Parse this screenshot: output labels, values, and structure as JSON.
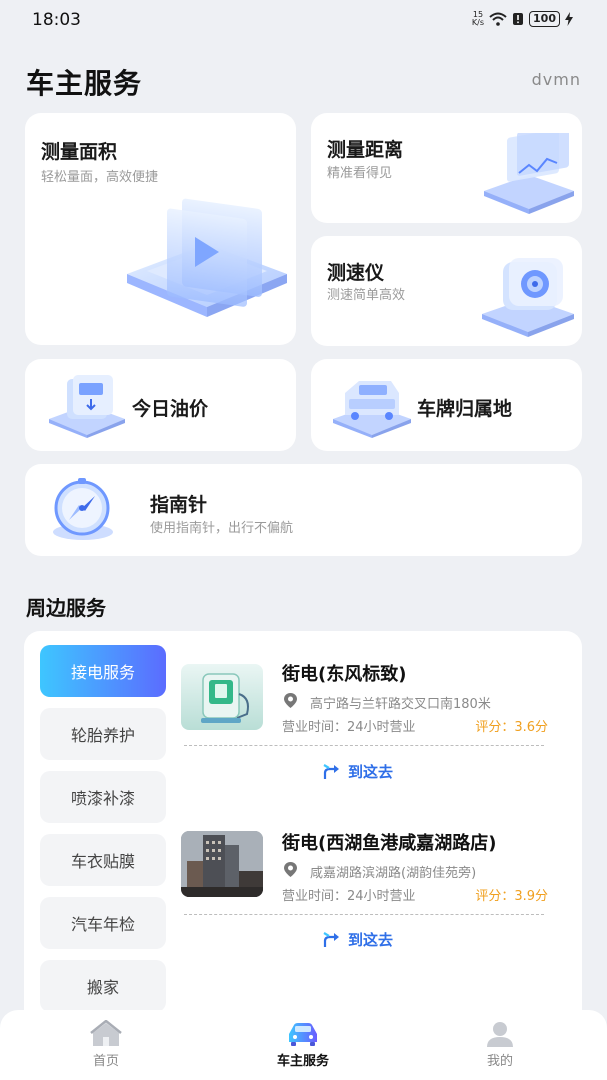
{
  "status": {
    "time": "18:03",
    "speed_top": "15",
    "speed_unit": "K/s",
    "battery": "100"
  },
  "header": {
    "title": "车主服务",
    "user": "dvmn"
  },
  "services": {
    "area": {
      "title": "测量面积",
      "subtitle": "轻松量面，高效便捷",
      "icon": "area-measure-icon"
    },
    "distance": {
      "title": "测量距离",
      "subtitle": "精准看得见",
      "icon": "distance-measure-icon"
    },
    "speed": {
      "title": "测速仪",
      "subtitle": "测速简单高效",
      "icon": "speedometer-icon"
    },
    "oil": {
      "title": "今日油价",
      "icon": "fuel-pump-icon"
    },
    "plate": {
      "title": "车牌归属地",
      "icon": "truck-icon"
    },
    "compass": {
      "title": "指南针",
      "subtitle": "使用指南针，出行不偏航",
      "icon": "compass-icon"
    }
  },
  "nearby": {
    "title": "周边服务",
    "categories": [
      "接电服务",
      "轮胎养护",
      "喷漆补漆",
      "车衣贴膜",
      "汽车年检",
      "搬家"
    ],
    "active_category": "接电服务",
    "shops": [
      {
        "name": "街电(东风标致)",
        "address": "高宁路与兰轩路交叉口南180米",
        "hours": "营业时间：24小时营业",
        "rating": "评分：3.6分",
        "action": "到这去"
      },
      {
        "name": "街电(西湖鱼港咸嘉湖路店)",
        "address": "咸嘉湖路滨湖路(湖韵佳苑旁)",
        "hours": "营业时间：24小时营业",
        "rating": "评分：3.9分",
        "action": "到这去"
      }
    ]
  },
  "nav": {
    "home": "首页",
    "car": "车主服务",
    "mine": "我的"
  },
  "colors": {
    "accent": "#2f6fe8",
    "rating": "#f0a020",
    "active_gradient_start": "#3ec6ff",
    "active_gradient_end": "#5b6cff"
  }
}
